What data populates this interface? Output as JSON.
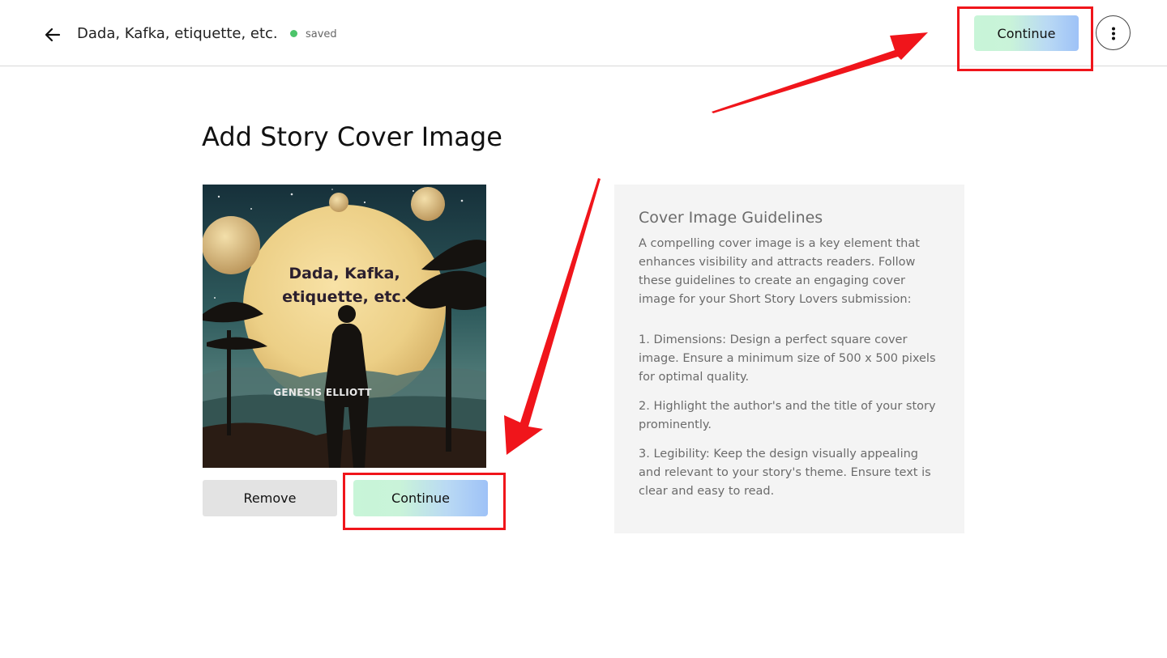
{
  "header": {
    "title": "Dada, Kafka, etiquette, etc.",
    "save_status": "saved",
    "continue_label": "Continue"
  },
  "main": {
    "heading": "Add Story Cover Image",
    "cover": {
      "title_text": "Dada, Kafka, etiquette, etc.",
      "author_text": "GENESIS ELLIOTT"
    },
    "remove_label": "Remove",
    "continue_label": "Continue"
  },
  "guidelines": {
    "title": "Cover Image Guidelines",
    "intro": "A compelling cover image is a key element that enhances visibility and attracts readers. Follow these guidelines to create an engaging cover image for your Short Story Lovers submission:",
    "items": [
      "1. Dimensions: Design a perfect square cover image. Ensure a minimum size of 500 x 500 pixels for optimal quality.",
      "2. Highlight the author's and the title of your story prominently.",
      "3. Legibility: Keep the design visually appealing and relevant to your story's theme. Ensure text is clear and easy to read."
    ]
  },
  "icons": {
    "back": "arrow-left-icon",
    "more": "more-vertical-icon",
    "status": "status-dot-icon"
  },
  "colors": {
    "status_green": "#4cc46a",
    "continue_gradient_start": "#c8f5d8",
    "continue_gradient_end": "#9ec2f7",
    "annotation_red": "#f0151b",
    "panel_bg": "#f4f4f4"
  }
}
